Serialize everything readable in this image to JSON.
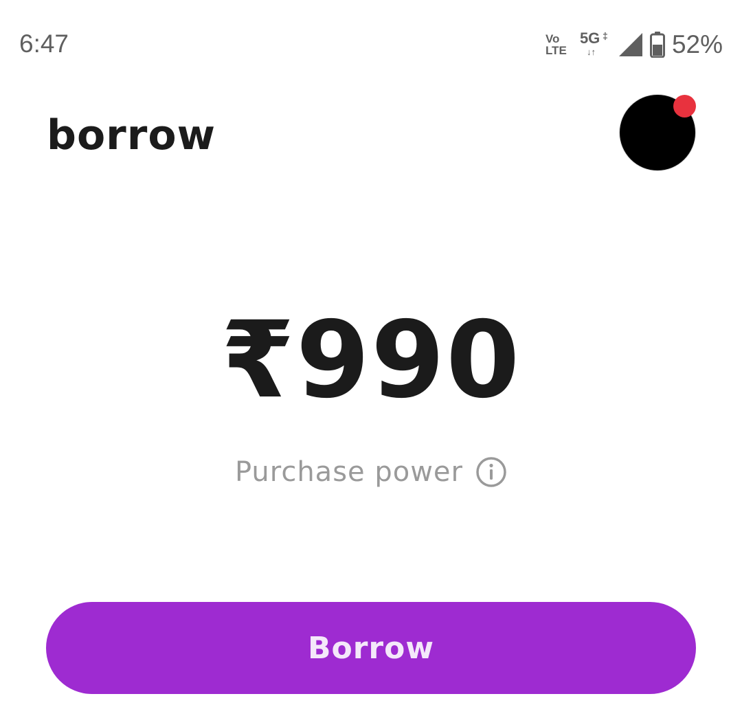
{
  "status_bar": {
    "time": "6:47",
    "volte_top": "Vo",
    "volte_bottom": "LTE",
    "network": "5G",
    "network_plus": "‡",
    "network_arrows": "↓↑",
    "battery": "52%",
    "icons": [
      "volte-icon",
      "5g-icon",
      "signal-icon",
      "battery-icon"
    ]
  },
  "header": {
    "title": "borrow"
  },
  "balance": {
    "amount": "₹990",
    "label": "Purchase power"
  },
  "actions": {
    "borrow_label": "Borrow"
  },
  "colors": {
    "accent": "#9e2bd1",
    "notification_dot": "#e8323e",
    "text_primary": "#1b1b1b",
    "text_secondary": "#9a9a9a"
  }
}
